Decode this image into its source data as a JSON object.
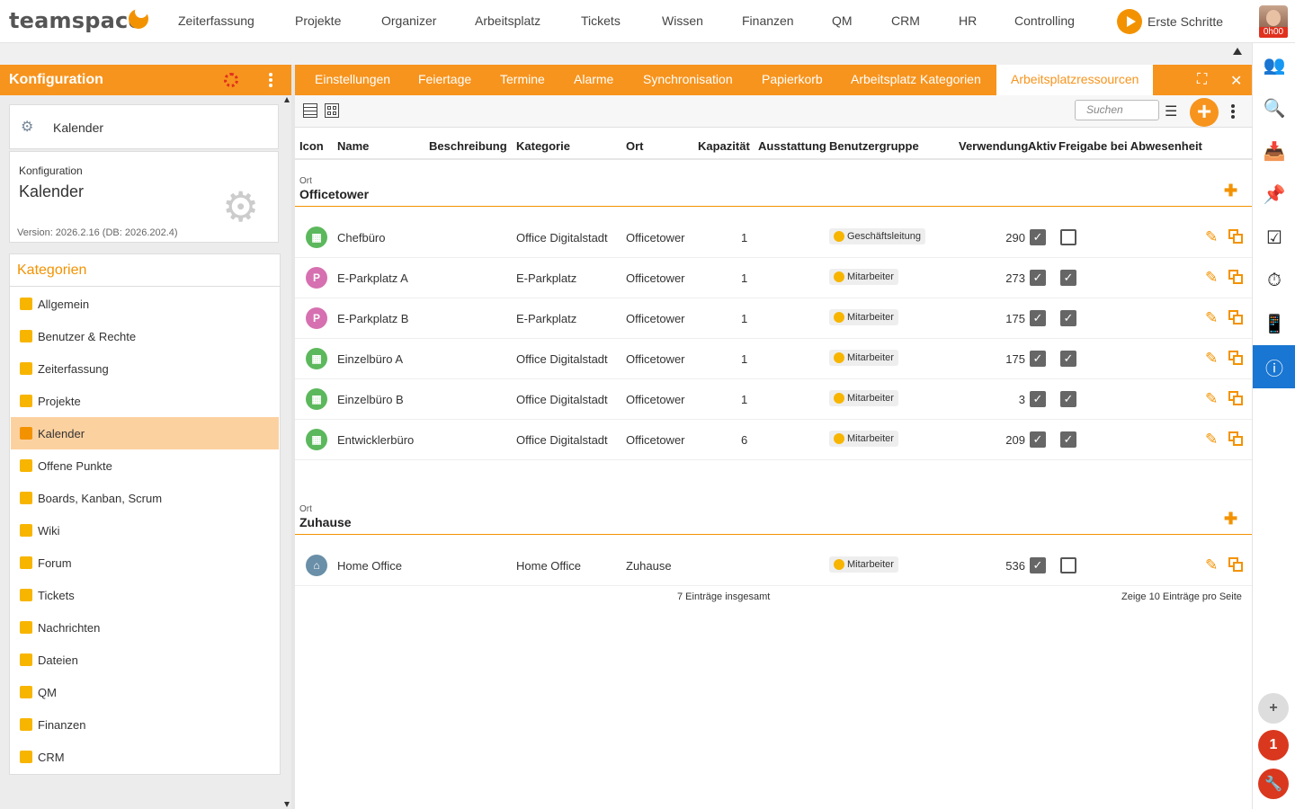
{
  "app": {
    "logo": "teamspace",
    "time_badge": "0h00",
    "start_label": "Erste Schritte"
  },
  "topnav": [
    "Zeiterfassung",
    "Projekte",
    "Organizer",
    "Arbeitsplatz",
    "Tickets",
    "Wissen",
    "Finanzen",
    "QM",
    "CRM",
    "HR",
    "Controlling"
  ],
  "left": {
    "header": "Konfiguration",
    "module_name": "Kalender",
    "info_label": "Konfiguration",
    "info_title": "Kalender",
    "version": "Version: 2026.2.16 (DB: 2026.202.4)",
    "categories_title": "Kategorien",
    "categories": [
      {
        "label": "Allgemein",
        "icon": "gears-icon",
        "selected": false
      },
      {
        "label": "Benutzer & Rechte",
        "icon": "users-icon",
        "selected": false
      },
      {
        "label": "Zeiterfassung",
        "icon": "stopwatch-icon",
        "selected": false
      },
      {
        "label": "Projekte",
        "icon": "folder-icon",
        "selected": false
      },
      {
        "label": "Kalender",
        "icon": "calendar-icon",
        "selected": true
      },
      {
        "label": "Offene Punkte",
        "icon": "sticky-note-icon",
        "selected": false
      },
      {
        "label": "Boards, Kanban, Scrum",
        "icon": "board-icon",
        "selected": false
      },
      {
        "label": "Wiki",
        "icon": "wiki-icon",
        "selected": false
      },
      {
        "label": "Forum",
        "icon": "forum-icon",
        "selected": false
      },
      {
        "label": "Tickets",
        "icon": "ticket-icon",
        "selected": false
      },
      {
        "label": "Nachrichten",
        "icon": "messages-icon",
        "selected": false
      },
      {
        "label": "Dateien",
        "icon": "files-icon",
        "selected": false
      },
      {
        "label": "QM",
        "icon": "qm-icon",
        "selected": false
      },
      {
        "label": "Finanzen",
        "icon": "euro-icon",
        "selected": false
      },
      {
        "label": "CRM",
        "icon": "crm-icon",
        "selected": false
      }
    ]
  },
  "tabs": [
    "Einstellungen",
    "Feiertage",
    "Termine",
    "Alarme",
    "Synchronisation",
    "Papierkorb",
    "Arbeitsplatz Kategorien",
    "Arbeitsplatzressourcen"
  ],
  "active_tab": "Arbeitsplatzressourcen",
  "search": {
    "placeholder": "Suchen"
  },
  "columns": [
    "Icon",
    "Name",
    "Beschreibung",
    "Kategorie",
    "Ort",
    "Kapazität",
    "Ausstattung",
    "Benutzergruppe",
    "Verwendung",
    "Aktiv",
    "Freigabe bei Abwesenheit"
  ],
  "groups": [
    {
      "label": "Ort",
      "value": "Officetower",
      "rows": [
        {
          "name": "Chefbüro",
          "kategorie": "Office Digitalstadt",
          "ort": "Officetower",
          "kapazitaet": "1",
          "gruppe": "Geschäftsleitung",
          "verwendung": "290",
          "aktiv": true,
          "freigabe": false,
          "icon": "workplace-icon",
          "color": "#5cb85c"
        },
        {
          "name": "E-Parkplatz A",
          "kategorie": "E-Parkplatz",
          "ort": "Officetower",
          "kapazitaet": "1",
          "gruppe": "Mitarbeiter",
          "verwendung": "273",
          "aktiv": true,
          "freigabe": true,
          "icon": "parking-icon",
          "color": "#d670b0"
        },
        {
          "name": "E-Parkplatz B",
          "kategorie": "E-Parkplatz",
          "ort": "Officetower",
          "kapazitaet": "1",
          "gruppe": "Mitarbeiter",
          "verwendung": "175",
          "aktiv": true,
          "freigabe": true,
          "icon": "parking-icon",
          "color": "#d670b0"
        },
        {
          "name": "Einzelbüro A",
          "kategorie": "Office Digitalstadt",
          "ort": "Officetower",
          "kapazitaet": "1",
          "gruppe": "Mitarbeiter",
          "verwendung": "175",
          "aktiv": true,
          "freigabe": true,
          "icon": "workplace-icon",
          "color": "#5cb85c"
        },
        {
          "name": "Einzelbüro B",
          "kategorie": "Office Digitalstadt",
          "ort": "Officetower",
          "kapazitaet": "1",
          "gruppe": "Mitarbeiter",
          "verwendung": "3",
          "aktiv": true,
          "freigabe": true,
          "icon": "workplace-icon",
          "color": "#5cb85c"
        },
        {
          "name": "Entwicklerbüro",
          "kategorie": "Office Digitalstadt",
          "ort": "Officetower",
          "kapazitaet": "6",
          "gruppe": "Mitarbeiter",
          "verwendung": "209",
          "aktiv": true,
          "freigabe": true,
          "icon": "workplace-icon",
          "color": "#5cb85c"
        }
      ]
    },
    {
      "label": "Ort",
      "value": "Zuhause",
      "rows": [
        {
          "name": "Home Office",
          "kategorie": "Home Office",
          "ort": "Zuhause",
          "kapazitaet": "",
          "gruppe": "Mitarbeiter",
          "verwendung": "536",
          "aktiv": true,
          "freigabe": false,
          "icon": "home-icon",
          "color": "#6a8fa8"
        }
      ]
    }
  ],
  "footer": {
    "total": "7 Einträge insgesamt",
    "paging": "Zeige  10  Einträge pro Seite"
  },
  "notifications": "1",
  "colors": {
    "accent": "#f7941d",
    "selected": "#fcd1a0",
    "info": "#1976d2",
    "alert": "#e0301e"
  }
}
